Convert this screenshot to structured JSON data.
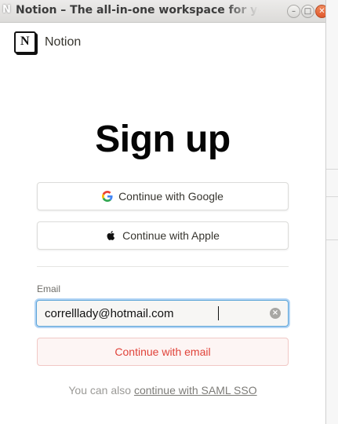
{
  "window": {
    "title": "Notion – The all-in-one workspace for yo",
    "app_glyph": "N",
    "controls": {
      "minimize": "–",
      "maximize": "□",
      "close": "✕"
    }
  },
  "brand": {
    "logo_letter": "N",
    "name": "Notion"
  },
  "heading": "Sign up",
  "buttons": {
    "google": "Continue with Google",
    "apple": "Continue with Apple",
    "email": "Continue with email"
  },
  "email": {
    "label": "Email",
    "value": "correlllady@hotmail.com"
  },
  "saml": {
    "prefix": "You can also ",
    "link": "continue with SAML SSO"
  },
  "colors": {
    "accent_blue": "#2383e2",
    "email_button_text": "#e0433a",
    "email_button_bg": "#fdf5f4"
  },
  "icons": [
    "google-icon",
    "apple-icon",
    "clear-icon",
    "notion-logo"
  ]
}
